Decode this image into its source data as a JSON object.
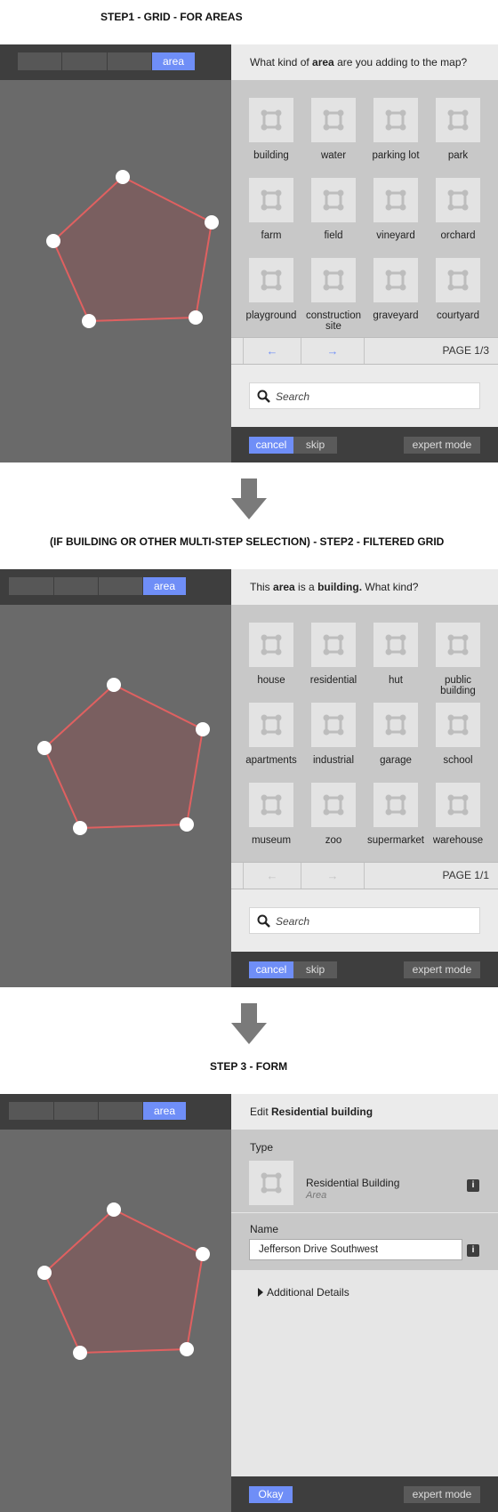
{
  "step1": {
    "caption": "STEP1 - GRID - FOR AREAS",
    "mode_active": "area",
    "header_pre": "What kind of ",
    "header_bold": "area",
    "header_post": " are you adding to the map?",
    "tiles": [
      {
        "label": "building"
      },
      {
        "label": "water"
      },
      {
        "label": "parking lot"
      },
      {
        "label": "park"
      },
      {
        "label": "farm"
      },
      {
        "label": "field"
      },
      {
        "label": "vineyard"
      },
      {
        "label": "orchard"
      },
      {
        "label": "playground"
      },
      {
        "label": "construction site"
      },
      {
        "label": "graveyard"
      },
      {
        "label": "courtyard"
      }
    ],
    "prev_arrow": "←",
    "next_arrow": "→",
    "page": "PAGE 1/3",
    "search_placeholder": "Search",
    "cancel": "cancel",
    "skip": "skip",
    "expert": "expert mode"
  },
  "step2": {
    "caption": "(IF BUILDING OR OTHER MULTI-STEP SELECTION) - STEP2 - FILTERED GRID",
    "mode_active": "area",
    "header_pre": "This ",
    "header_bold": "area",
    "header_mid": " is a ",
    "header_bold2": "building.",
    "header_post": " What kind?",
    "tiles": [
      {
        "label": "house"
      },
      {
        "label": "residential"
      },
      {
        "label": "hut"
      },
      {
        "label": "public building"
      },
      {
        "label": "apartments"
      },
      {
        "label": "industrial"
      },
      {
        "label": "garage"
      },
      {
        "label": "school"
      },
      {
        "label": "museum"
      },
      {
        "label": "zoo"
      },
      {
        "label": "supermarket"
      },
      {
        "label": "warehouse"
      }
    ],
    "prev_arrow": "←",
    "next_arrow": "→",
    "page": "PAGE 1/1",
    "search_placeholder": "Search",
    "cancel": "cancel",
    "skip": "skip",
    "expert": "expert mode"
  },
  "step3": {
    "caption": "STEP 3 - FORM",
    "mode_active": "area",
    "header_pre": "Edit ",
    "header_bold": "Residential building",
    "type_label": "Type",
    "type_name": "Residential Building",
    "type_sub": "Area",
    "info_glyph": "i",
    "name_label": "Name",
    "name_value": "Jefferson Drive Southwest",
    "details_label": "Additional Details",
    "okay": "Okay",
    "expert": "expert mode"
  },
  "colors": {
    "accent": "#6f8ef7",
    "polygon_stroke": "#e06060",
    "polygon_fill": "#7a5f60",
    "map_bg": "#6a6a6a",
    "toolbar_bg": "#3e3e3e"
  }
}
